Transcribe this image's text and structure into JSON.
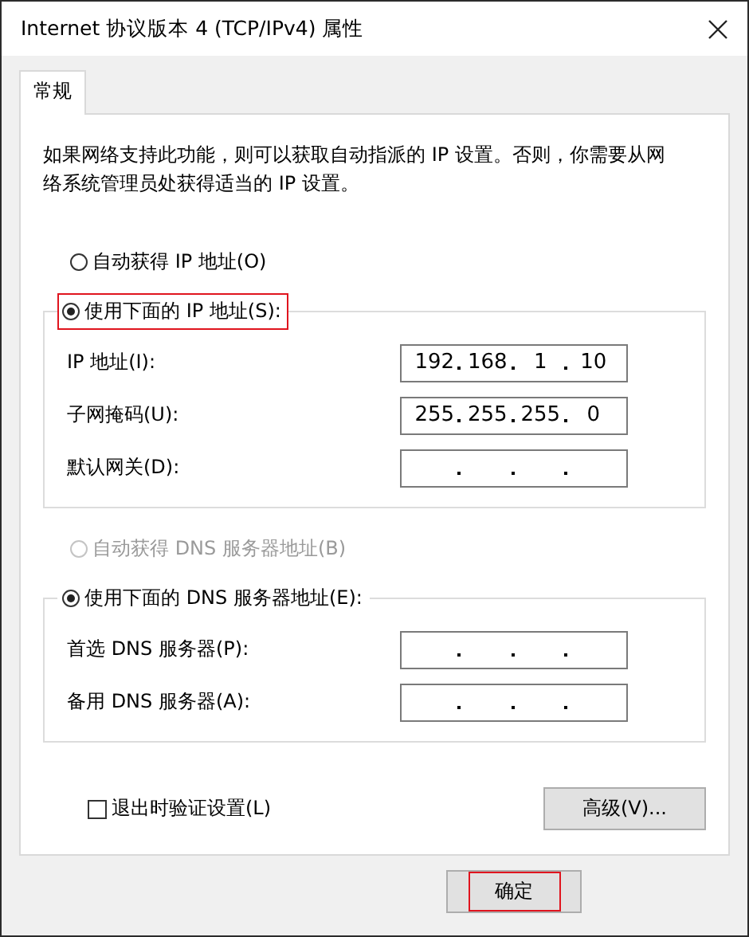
{
  "window": {
    "title": "Internet 协议版本 4 (TCP/IPv4) 属性"
  },
  "tabs": [
    {
      "label": "常规",
      "selected": true
    }
  ],
  "description": "如果网络支持此功能，则可以获取自动指派的 IP 设置。否则，你需要从网络系统管理员处获得适当的 IP 设置。",
  "ip_section": {
    "options": [
      {
        "label": "自动获得 IP 地址(O)",
        "selected": false,
        "disabled": false,
        "highlighted": false
      },
      {
        "label": "使用下面的 IP 地址(S):",
        "selected": true,
        "disabled": false,
        "highlighted": true
      }
    ],
    "fields": [
      {
        "label": "IP 地址(I):",
        "octets": [
          "192",
          "168",
          "1",
          "10"
        ]
      },
      {
        "label": "子网掩码(U):",
        "octets": [
          "255",
          "255",
          "255",
          "0"
        ]
      },
      {
        "label": "默认网关(D):"
      }
    ]
  },
  "dns_section": {
    "options": [
      {
        "label": "自动获得 DNS 服务器地址(B)",
        "selected": false,
        "disabled": true,
        "highlighted": false
      },
      {
        "label": "使用下面的 DNS 服务器地址(E):",
        "selected": true,
        "disabled": false,
        "highlighted": false
      }
    ],
    "fields": [
      {
        "label": "首选 DNS 服务器(P):"
      },
      {
        "label": "备用 DNS 服务器(A):"
      }
    ]
  },
  "validate_on_exit": {
    "label": "退出时验证设置(L)",
    "checked": false
  },
  "advanced_button": "高级(V)...",
  "buttons": [
    {
      "label": "确定",
      "highlighted": true
    }
  ]
}
